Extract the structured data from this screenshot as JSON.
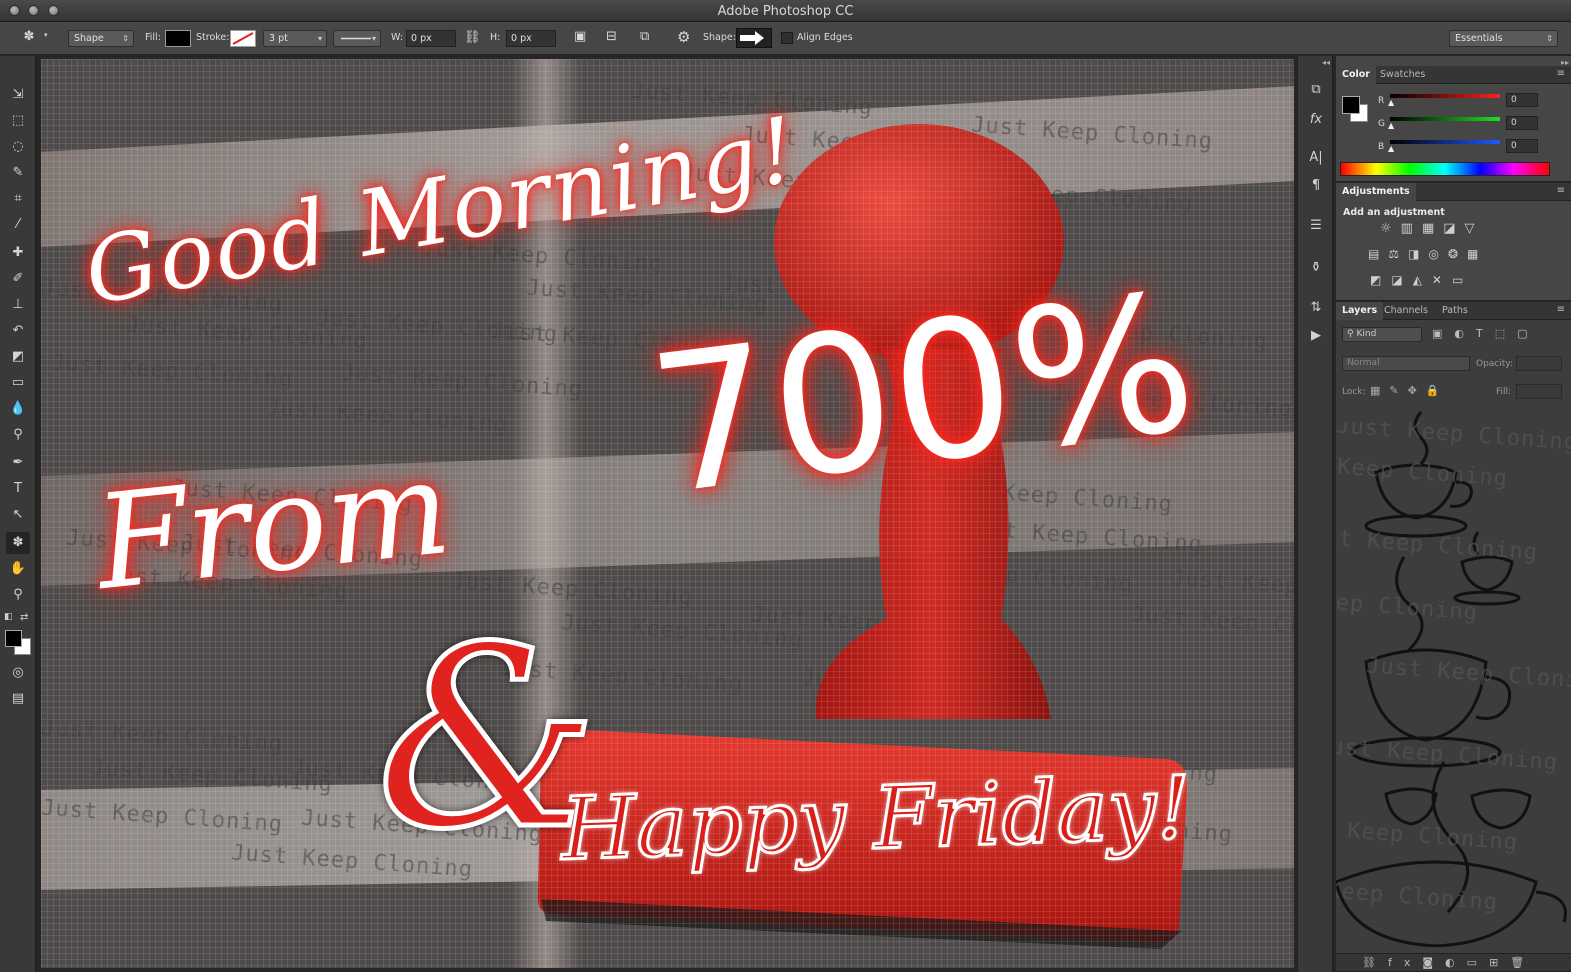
{
  "app": {
    "title": "Adobe Photoshop CC"
  },
  "options_bar": {
    "mode": "Shape",
    "fill_label": "Fill:",
    "stroke_label": "Stroke:",
    "stroke_width": "3 pt",
    "w_label": "W:",
    "w_value": "0 px",
    "h_label": "H:",
    "h_value": "0 px",
    "shape_label": "Shape:",
    "align_edges_label": "Align Edges",
    "workspace": "Essentials"
  },
  "color_panel": {
    "tabs": [
      "Color",
      "Swatches"
    ],
    "channels": [
      {
        "name": "R",
        "value": "0",
        "color": "#d22a2a"
      },
      {
        "name": "G",
        "value": "0",
        "color": "#2ab02a"
      },
      {
        "name": "B",
        "value": "0",
        "color": "#2a55d2"
      }
    ]
  },
  "adjustments_panel": {
    "title": "Adjustments",
    "subtitle": "Add an adjustment"
  },
  "layers_panel": {
    "tabs": [
      "Layers",
      "Channels",
      "Paths"
    ],
    "filter": "Kind",
    "blend_mode": "Normal",
    "opacity_label": "Opacity:",
    "lock_label": "Lock:",
    "fill_label": "Fill:"
  },
  "canvas": {
    "headline_1": "Good Morning!",
    "headline_2": "From",
    "headline_3": "700%",
    "ampersand": "&",
    "headline_4": "Happy Friday!",
    "watermark": "Just Keep Cloning",
    "accent_color": "#e0231f"
  }
}
